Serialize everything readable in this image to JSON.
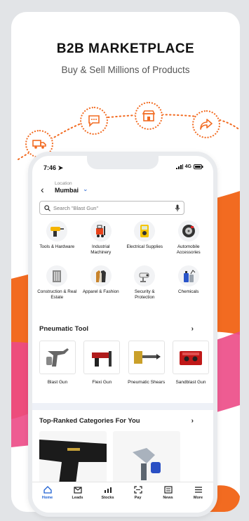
{
  "hero": {
    "title": "B2B MARKETPLACE",
    "subtitle": "Buy & Sell Millions of Products"
  },
  "colors": {
    "accent": "#f26b21",
    "pink": "#ec4a86",
    "brand_blue": "#1d5fd1"
  },
  "status_bar": {
    "time": "7:46",
    "network": "4G"
  },
  "location": {
    "label": "Location",
    "city": "Mumbai"
  },
  "search": {
    "placeholder": "Search \"Blast Gun\""
  },
  "categories": [
    {
      "label": "Tools & Hardware",
      "icon": "drill-icon"
    },
    {
      "label": "Industrial Machinery",
      "icon": "forklift-icon"
    },
    {
      "label": "Electrical Supplies",
      "icon": "multimeter-icon"
    },
    {
      "label": "Automobile Accessories",
      "icon": "tyre-icon"
    },
    {
      "label": "Construction & Real Estate",
      "icon": "building-icon"
    },
    {
      "label": "Apparel & Fashion",
      "icon": "clothes-icon"
    },
    {
      "label": "Security & Protection",
      "icon": "cctv-icon"
    },
    {
      "label": "Chemicals",
      "icon": "chemical-bottle-icon"
    }
  ],
  "pneumatic": {
    "title": "Pneumatic Tool",
    "products": [
      {
        "label": "Blast Gun",
        "icon": "spray-gun-icon"
      },
      {
        "label": "Flexi Gun",
        "icon": "nail-gun-icon"
      },
      {
        "label": "Pneumatic Shears",
        "icon": "shears-icon"
      },
      {
        "label": "Sandblast Gun",
        "icon": "sandblast-cabinet-icon"
      }
    ]
  },
  "top_ranked": {
    "title": "Top-Ranked Categories For You"
  },
  "tabs": [
    {
      "label": "Home",
      "icon": "home-icon",
      "active": true
    },
    {
      "label": "Leads",
      "icon": "mail-icon"
    },
    {
      "label": "Stocks",
      "icon": "stocks-icon"
    },
    {
      "label": "Pay",
      "icon": "scan-pay-icon"
    },
    {
      "label": "News",
      "icon": "news-icon"
    },
    {
      "label": "More",
      "icon": "menu-icon"
    }
  ]
}
